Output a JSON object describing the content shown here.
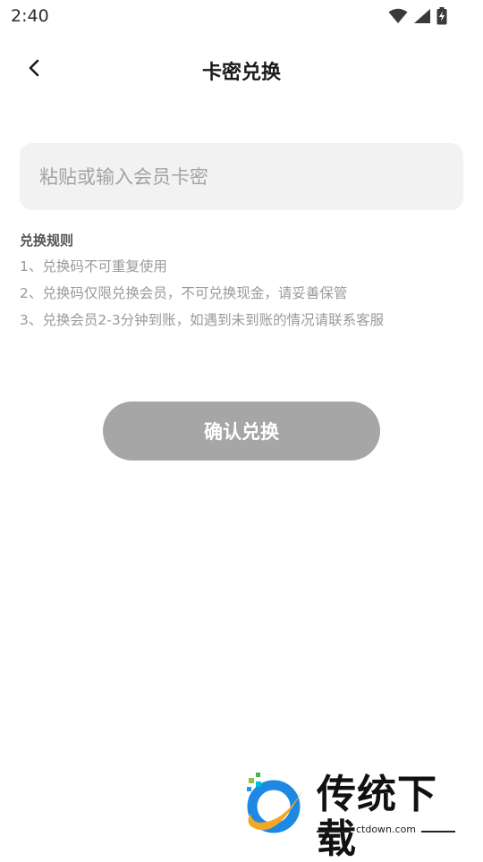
{
  "status_bar": {
    "time": "2:40",
    "icons": [
      "wifi-icon",
      "cellular-signal-icon",
      "battery-charging-icon"
    ]
  },
  "header": {
    "title": "卡密兑换",
    "back_icon": "chevron-left-icon"
  },
  "card_input": {
    "placeholder": "粘贴或输入会员卡密",
    "value": ""
  },
  "rules": {
    "title": "兑换规则",
    "items": [
      "1、兑换码不可重复使用",
      "2、兑换码仅限兑换会员，不可兑换现金，请妥善保管",
      "3、兑换会员2-3分钟到账，如遇到未到账的情况请联系客服"
    ]
  },
  "confirm_button": {
    "label": "确认兑换"
  },
  "watermark": {
    "name": "传统下载",
    "url": "ctdown.com"
  },
  "colors": {
    "button_disabled": "#a6a6a6",
    "input_background": "#f2f2f2",
    "rule_text": "#9a9a9a",
    "logo_blue": "#1e88e5",
    "logo_orange": "#f5a623",
    "logo_green": "#8bc34a"
  }
}
